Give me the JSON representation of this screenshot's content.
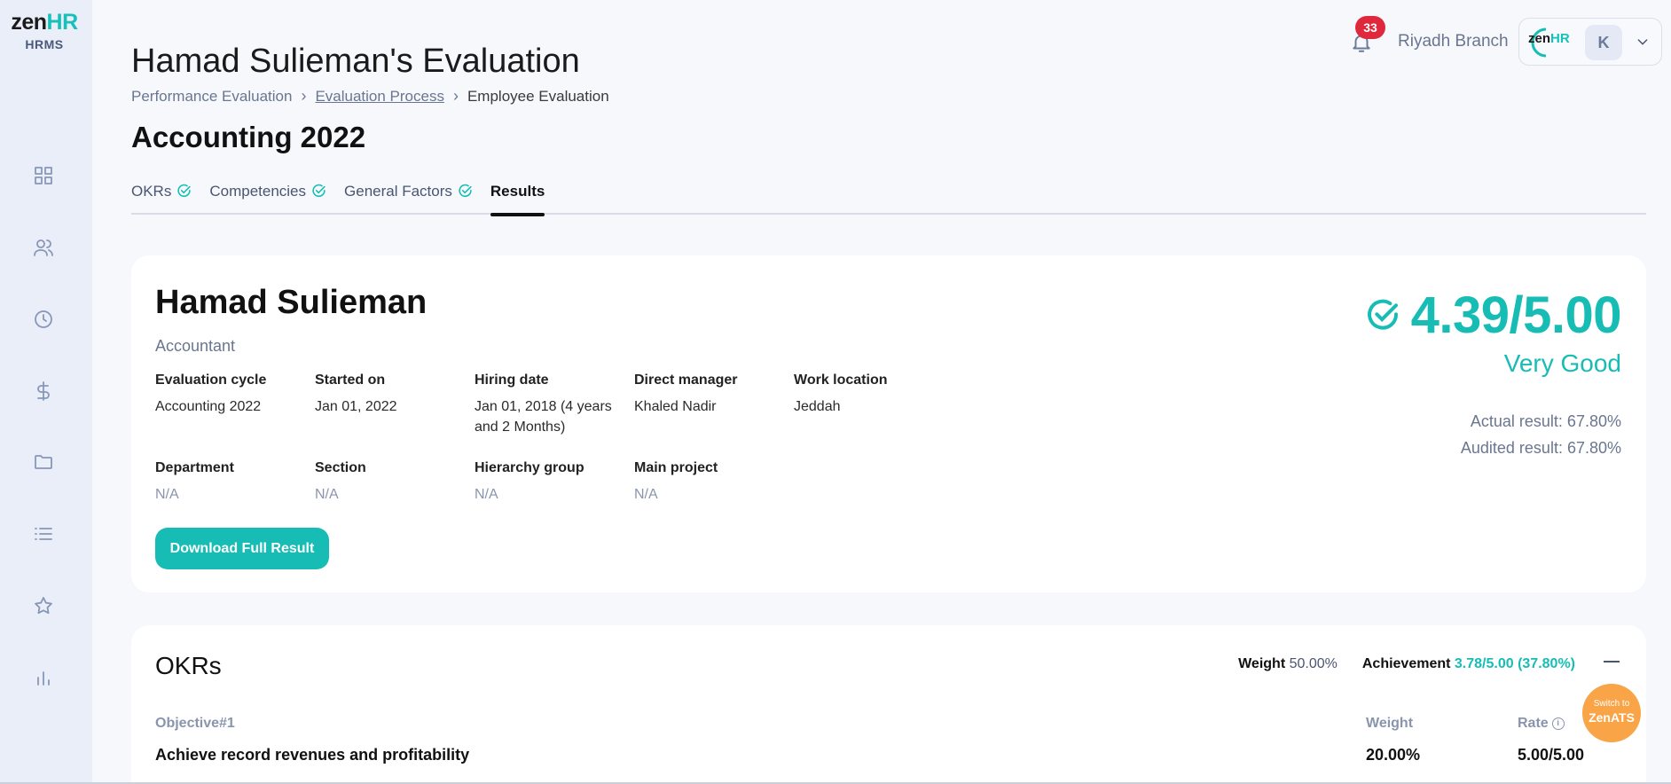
{
  "brand": {
    "logo_zen": "zen",
    "logo_hr": "HR",
    "subtitle": "HRMS"
  },
  "sidebar": {
    "icons": [
      "dashboard-icon",
      "people-icon",
      "clock-icon",
      "dollar-icon",
      "folder-icon",
      "list-icon",
      "star-icon",
      "chart-icon"
    ]
  },
  "header": {
    "title": "Hamad Sulieman's Evaluation",
    "breadcrumb": [
      "Performance Evaluation",
      "Evaluation Process",
      "Employee Evaluation"
    ],
    "subtitle": "Accounting 2022",
    "notifications_count": "33",
    "branch": "Riyadh Branch",
    "avatar_initial": "K",
    "mini_logo_zen": "zen",
    "mini_logo_hr": "HR"
  },
  "tabs": [
    {
      "label": "OKRs",
      "done": true
    },
    {
      "label": "Competencies",
      "done": true
    },
    {
      "label": "General Factors",
      "done": true
    },
    {
      "label": "Results",
      "active": true
    }
  ],
  "employee": {
    "name": "Hamad Sulieman",
    "role": "Accountant",
    "fields": [
      {
        "label": "Evaluation cycle",
        "value": "Accounting 2022"
      },
      {
        "label": "Started on",
        "value": "Jan 01, 2022"
      },
      {
        "label": "Hiring date",
        "value": "Jan 01, 2018 (4 years and 2 Months)"
      },
      {
        "label": "Direct manager",
        "value": "Khaled Nadir"
      },
      {
        "label": "Work location",
        "value": "Jeddah"
      },
      {
        "label": "Department",
        "value": "N/A"
      },
      {
        "label": "Section",
        "value": "N/A"
      },
      {
        "label": "Hierarchy group",
        "value": "N/A"
      },
      {
        "label": "Main project",
        "value": "N/A"
      }
    ],
    "download_label": "Download Full Result"
  },
  "result": {
    "score": "4.39/5.00",
    "rating": "Very Good",
    "actual": "Actual result: 67.80%",
    "audited": "Audited result: 67.80%"
  },
  "okrs": {
    "title": "OKRs",
    "weight_label": "Weight",
    "weight_value": "50.00%",
    "achievement_label": "Achievement",
    "achievement_value": "3.78/5.00 (37.80%)",
    "objective_head": "Objective#1",
    "weight_head": "Weight",
    "rate_head": "Rate",
    "objective_text": "Achieve record revenues and profitability",
    "objective_weight": "20.00%",
    "objective_rate": "5.00/5.00"
  },
  "switch": {
    "line1": "Switch to",
    "line2": "ZenATS"
  },
  "colors": {
    "accent": "#17bdb5",
    "badge": "#e0283c",
    "switch": "#f9a447"
  }
}
